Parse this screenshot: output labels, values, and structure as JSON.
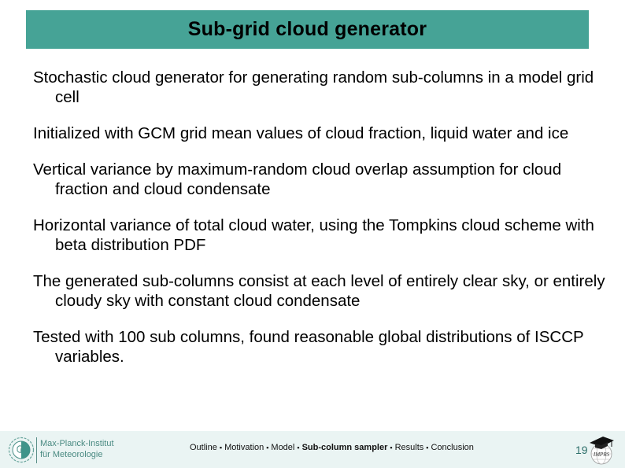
{
  "slide": {
    "title": "Sub-grid cloud generator",
    "bullets": [
      "Stochastic cloud generator for generating random sub-columns in a model grid cell",
      "Initialized with GCM grid mean values of cloud fraction, liquid water and ice",
      "Vertical variance by maximum-random cloud overlap assumption for cloud fraction and cloud condensate",
      "Horizontal variance of total cloud water, using the Tompkins cloud scheme with beta distribution PDF",
      "The generated sub-columns consist at each level of entirely clear sky, or entirely cloudy sky with constant cloud condensate",
      "Tested with 100 sub columns, found reasonable global distributions of ISCCP variables."
    ]
  },
  "footer": {
    "institute_line1": "Max-Planck-Institut",
    "institute_line2": "für Meteorologie",
    "institute_logo_icon": "mpi-minerva-logo-icon",
    "nav": [
      {
        "label": "Outline",
        "current": false
      },
      {
        "label": "Motivation",
        "current": false
      },
      {
        "label": "Model",
        "current": false
      },
      {
        "label": "Sub-column sampler",
        "current": true
      },
      {
        "label": "Results",
        "current": false
      },
      {
        "label": "Conclusion",
        "current": false
      }
    ],
    "separator": "▪",
    "page_number": "19",
    "school_logo_icon": "graduation-cap-globe-icon"
  },
  "colors": {
    "title_bar": "#46a396",
    "footer_bg": "#eaf4f3",
    "institute_text": "#4a8a82"
  }
}
